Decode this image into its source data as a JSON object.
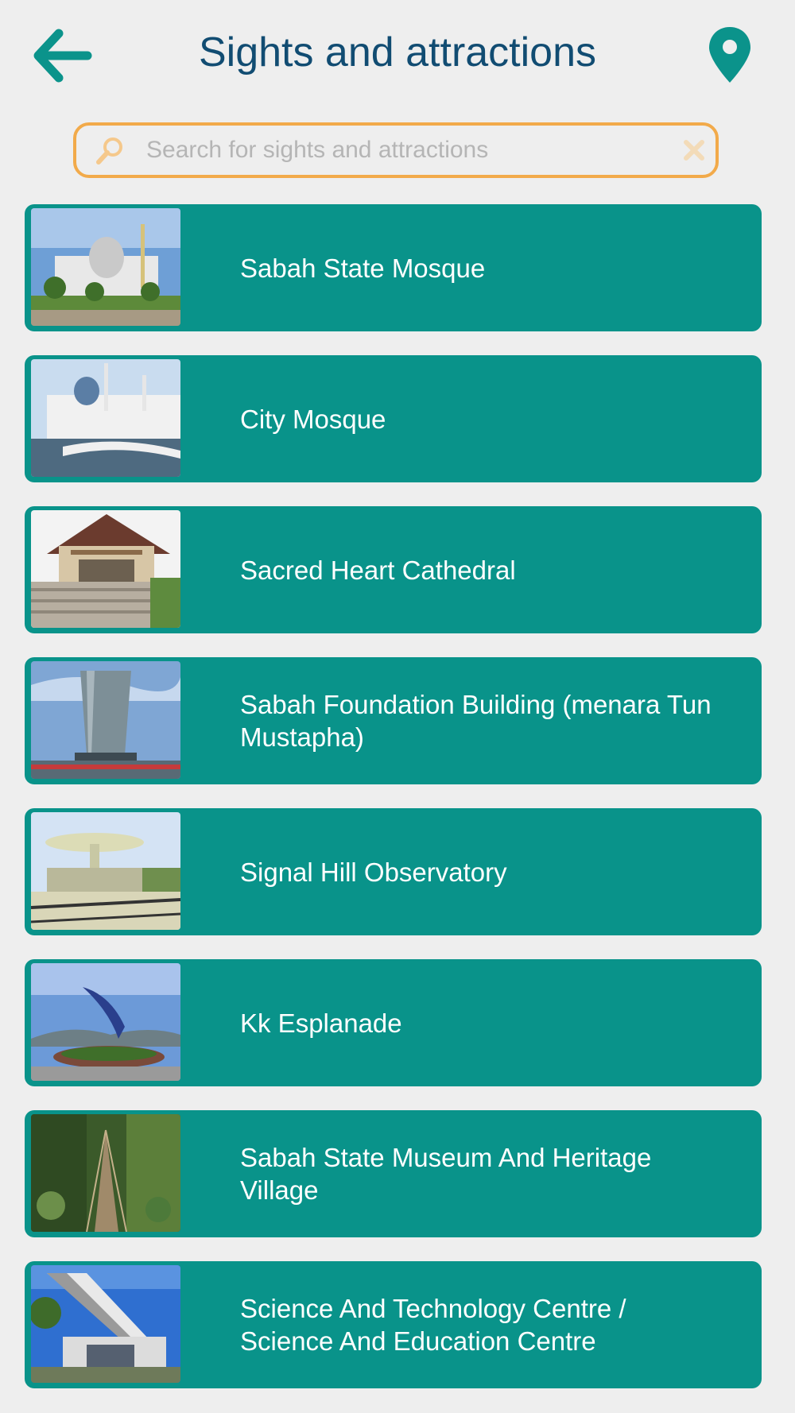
{
  "header": {
    "title": "Sights and attractions",
    "back_icon": "arrow-left-icon",
    "map_icon": "map-pin-icon",
    "accent_color": "#0b938b",
    "title_color": "#114c72"
  },
  "search": {
    "placeholder": "Search for sights and attractions",
    "value": "",
    "search_icon": "search-icon",
    "clear_icon": "close-icon",
    "border_color": "#f2aa4a"
  },
  "list": {
    "item_color": "#09938a",
    "items": [
      {
        "label": "Sabah State Mosque",
        "image": "photo of a mosque with silver dome"
      },
      {
        "label": "City Mosque",
        "image": "photo of a white mosque by the water"
      },
      {
        "label": "Sacred Heart Cathedral",
        "image": "photo of a cathedral with steps"
      },
      {
        "label": "Sabah Foundation Building (menara Tun Mustapha)",
        "image": "photo of a glass tower"
      },
      {
        "label": "Signal Hill Observatory",
        "image": "photo of an observation deck"
      },
      {
        "label": "Kk Esplanade",
        "image": "photo of a marlin statue"
      },
      {
        "label": "Sabah State Museum And Heritage Village",
        "image": "photo of a rope bridge in a forest"
      },
      {
        "label": "Science And Technology Centre / Science And Education Centre",
        "image": "photo of a modern building"
      }
    ]
  }
}
